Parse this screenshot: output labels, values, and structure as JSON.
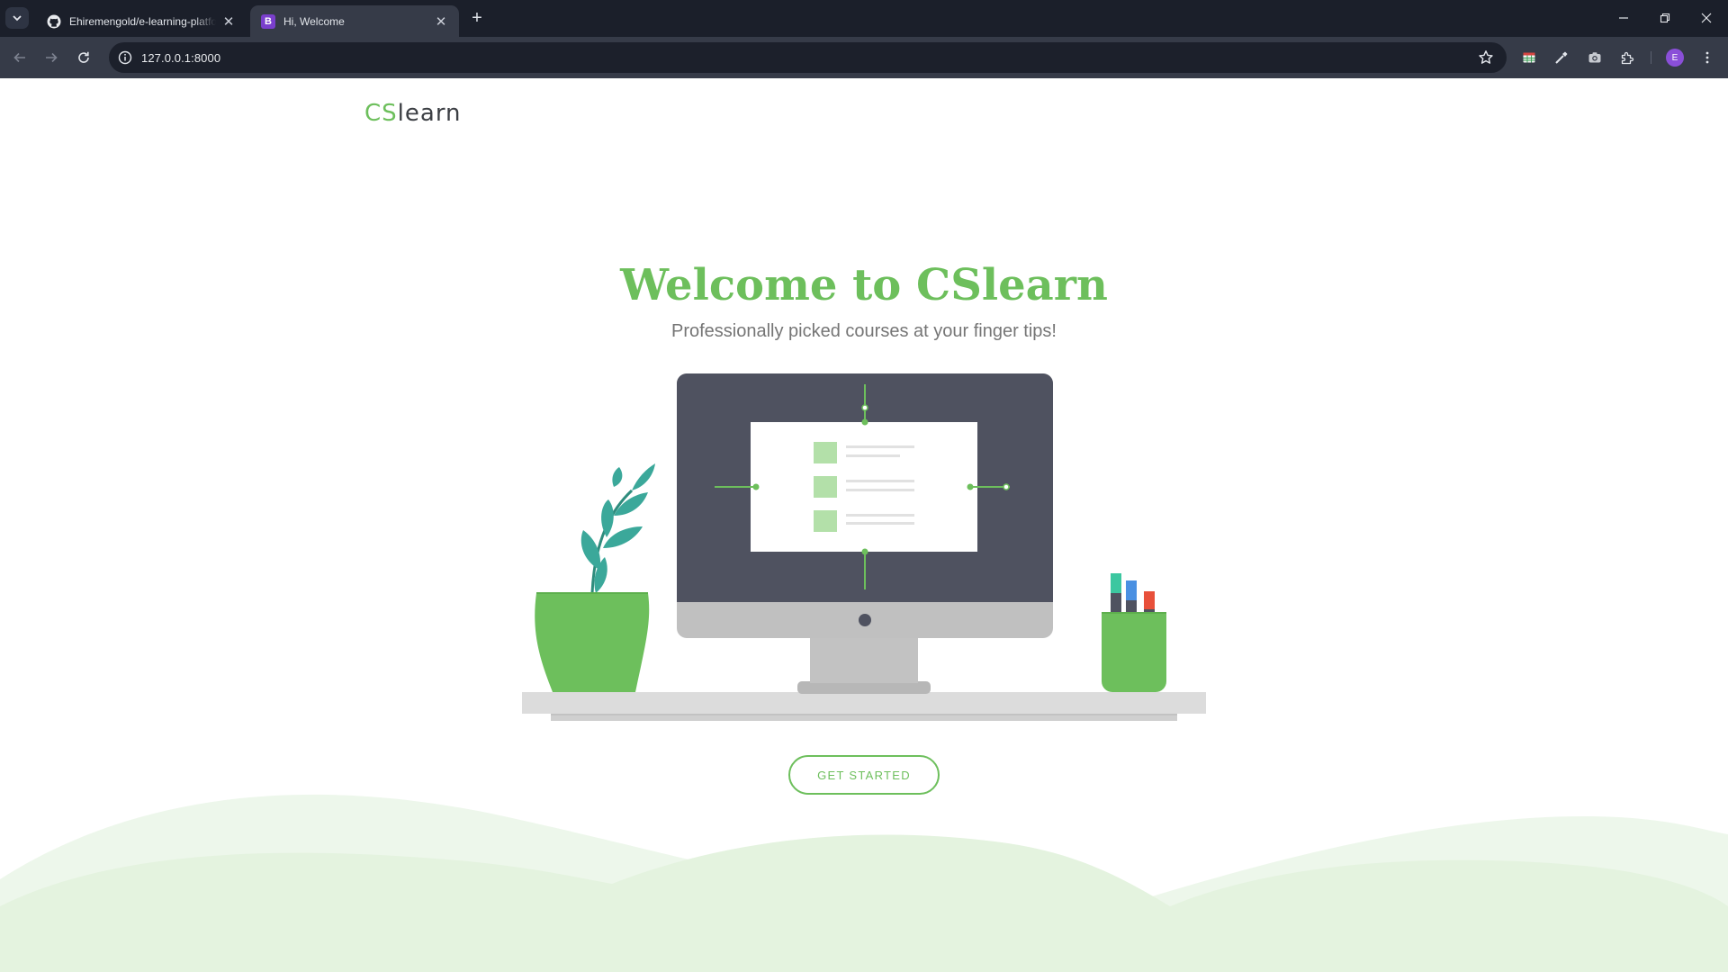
{
  "browser": {
    "tabs": [
      {
        "title": "Ehiremengold/e-learning-platform",
        "favicon": "github-icon"
      },
      {
        "title": "Hi, Welcome",
        "favicon": "bootstrap-icon",
        "favicon_letter": "B",
        "active": true
      }
    ],
    "url": "127.0.0.1:8000",
    "profile_initial": "E"
  },
  "page": {
    "logo": {
      "accent": "CS",
      "rest": "learn"
    },
    "hero": {
      "title": "Welcome to CSlearn",
      "subtitle": "Professionally picked courses at your finger tips!",
      "cta_label": "GET STARTED"
    }
  },
  "colors": {
    "brand_green": "#6dbf5c",
    "light_green": "#b3e0a9",
    "monitor_dark": "#4f5260",
    "leaf_teal": "#3ba89a",
    "wave_green": "#e5f3e1"
  }
}
